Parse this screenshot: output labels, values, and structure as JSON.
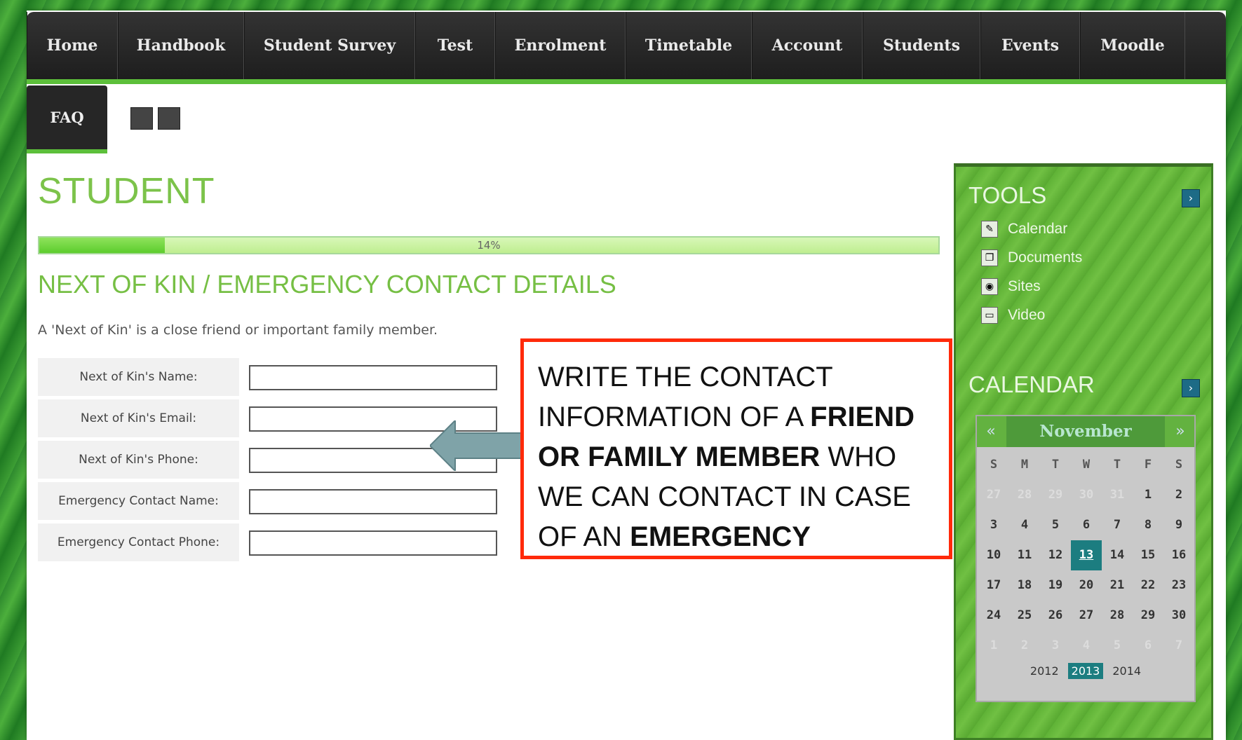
{
  "nav": {
    "items": [
      "Home",
      "Handbook",
      "Student Survey",
      "Test",
      "Enrolment",
      "Timetable",
      "Account",
      "Students",
      "Events",
      "Moodle"
    ],
    "faq": "FAQ"
  },
  "page": {
    "title": "STUDENT",
    "progress_label": "14%",
    "progress": 0.14,
    "section_title": "NEXT OF KIN / EMERGENCY CONTACT DETAILS",
    "intro": "A 'Next of Kin' is a close friend or important family member."
  },
  "form": {
    "fields": [
      {
        "label": "Next of Kin's Name:",
        "value": ""
      },
      {
        "label": "Next of Kin's Email:",
        "value": ""
      },
      {
        "label": "Next of Kin's Phone:",
        "value": ""
      },
      {
        "label": "Emergency Contact Name:",
        "value": ""
      },
      {
        "label": "Emergency Contact Phone:",
        "value": ""
      }
    ]
  },
  "callout": {
    "part1": "WRITE THE CONTACT INFORMATION OF A ",
    "bold1": "FRIEND OR FAMILY MEMBER",
    "part2": " WHO WE CAN CONTACT IN CASE OF AN ",
    "bold2": "EMERGENCY"
  },
  "sidebar": {
    "tools_heading": "TOOLS",
    "tools": [
      {
        "label": "Calendar",
        "icon": "calendar-icon"
      },
      {
        "label": "Documents",
        "icon": "documents-icon"
      },
      {
        "label": "Sites",
        "icon": "sites-icon"
      },
      {
        "label": "Video",
        "icon": "video-icon"
      }
    ],
    "calendar_heading": "CALENDAR",
    "calendar": {
      "month": "November",
      "prev": "«",
      "next": "»",
      "weekdays": [
        "S",
        "M",
        "T",
        "W",
        "T",
        "F",
        "S"
      ],
      "weeks": [
        [
          "27",
          "28",
          "29",
          "30",
          "31",
          "1",
          "2"
        ],
        [
          "3",
          "4",
          "5",
          "6",
          "7",
          "8",
          "9"
        ],
        [
          "10",
          "11",
          "12",
          "13",
          "14",
          "15",
          "16"
        ],
        [
          "17",
          "18",
          "19",
          "20",
          "21",
          "22",
          "23"
        ],
        [
          "24",
          "25",
          "26",
          "27",
          "28",
          "29",
          "30"
        ],
        [
          "1",
          "2",
          "3",
          "4",
          "5",
          "6",
          "7"
        ]
      ],
      "today": "13",
      "years": [
        "2012",
        "2013",
        "2014"
      ],
      "current_year": "2013"
    }
  },
  "colors": {
    "accent_green": "#5cbf3a",
    "callout_border": "#ff2a0a",
    "today_highlight": "#1c7d80"
  }
}
